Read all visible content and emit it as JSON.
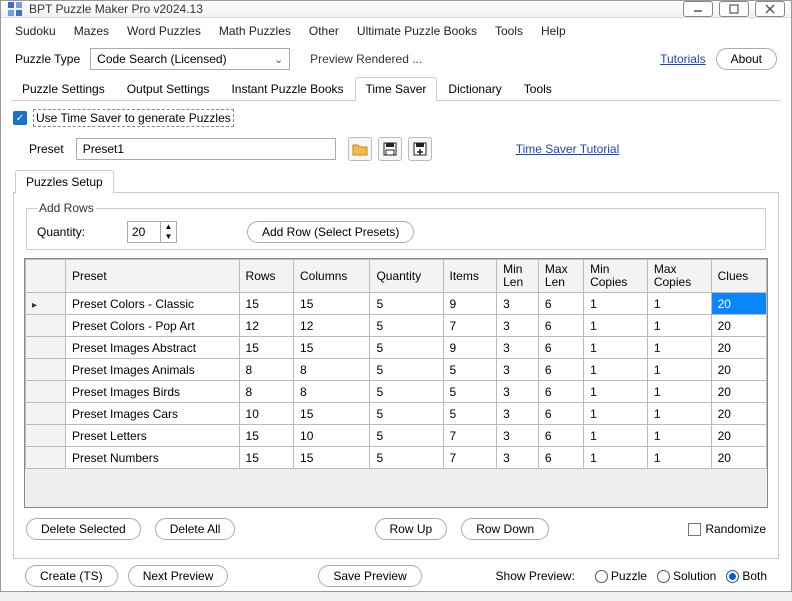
{
  "window": {
    "title": "BPT Puzzle Maker Pro v2024.13"
  },
  "menu": [
    "Sudoku",
    "Mazes",
    "Word Puzzles",
    "Math Puzzles",
    "Other",
    "Ultimate Puzzle Books",
    "Tools",
    "Help"
  ],
  "toolbar": {
    "puzzle_type_label": "Puzzle Type",
    "puzzle_type_value": "Code Search (Licensed)",
    "status": "Preview Rendered ...",
    "tutorials": "Tutorials",
    "about": "About"
  },
  "tabs": [
    "Puzzle Settings",
    "Output Settings",
    "Instant Puzzle Books",
    "Time Saver",
    "Dictionary",
    "Tools"
  ],
  "active_tab": "Time Saver",
  "timesaver": {
    "use_label": "Use Time Saver to generate Puzzles",
    "use_checked": true,
    "preset_label": "Preset",
    "preset_value": "Preset1",
    "tutorial_link": "Time Saver Tutorial"
  },
  "subtab": "Puzzles Setup",
  "addrows": {
    "legend": "Add Rows",
    "qty_label": "Quantity:",
    "qty_value": "20",
    "add_btn": "Add Row (Select Presets)"
  },
  "grid": {
    "headers": [
      "Preset",
      "Rows",
      "Columns",
      "Quantity",
      "Items",
      "Min\nLen",
      "Max\nLen",
      "Min\nCopies",
      "Max\nCopies",
      "Clues"
    ],
    "rows": [
      [
        "Preset Colors - Classic",
        "15",
        "15",
        "5",
        "9",
        "3",
        "6",
        "1",
        "1",
        "20"
      ],
      [
        "Preset Colors - Pop Art",
        "12",
        "12",
        "5",
        "7",
        "3",
        "6",
        "1",
        "1",
        "20"
      ],
      [
        "Preset Images Abstract",
        "15",
        "15",
        "5",
        "9",
        "3",
        "6",
        "1",
        "1",
        "20"
      ],
      [
        "Preset Images Animals",
        "8",
        "8",
        "5",
        "5",
        "3",
        "6",
        "1",
        "1",
        "20"
      ],
      [
        "Preset Images Birds",
        "8",
        "8",
        "5",
        "5",
        "3",
        "6",
        "1",
        "1",
        "20"
      ],
      [
        "Preset Images Cars",
        "10",
        "15",
        "5",
        "5",
        "3",
        "6",
        "1",
        "1",
        "20"
      ],
      [
        "Preset Letters",
        "15",
        "10",
        "5",
        "7",
        "3",
        "6",
        "1",
        "1",
        "20"
      ],
      [
        "Preset Numbers",
        "15",
        "15",
        "5",
        "7",
        "3",
        "6",
        "1",
        "1",
        "20"
      ]
    ],
    "selected": {
      "row": 0,
      "col": 9
    }
  },
  "buttons": {
    "delete_selected": "Delete Selected",
    "delete_all": "Delete All",
    "row_up": "Row Up",
    "row_down": "Row Down",
    "randomize": "Randomize"
  },
  "footer": {
    "create": "Create (TS)",
    "next_preview": "Next Preview",
    "save_preview": "Save Preview",
    "show_label": "Show Preview:",
    "options": [
      "Puzzle",
      "Solution",
      "Both"
    ],
    "selected": "Both"
  }
}
